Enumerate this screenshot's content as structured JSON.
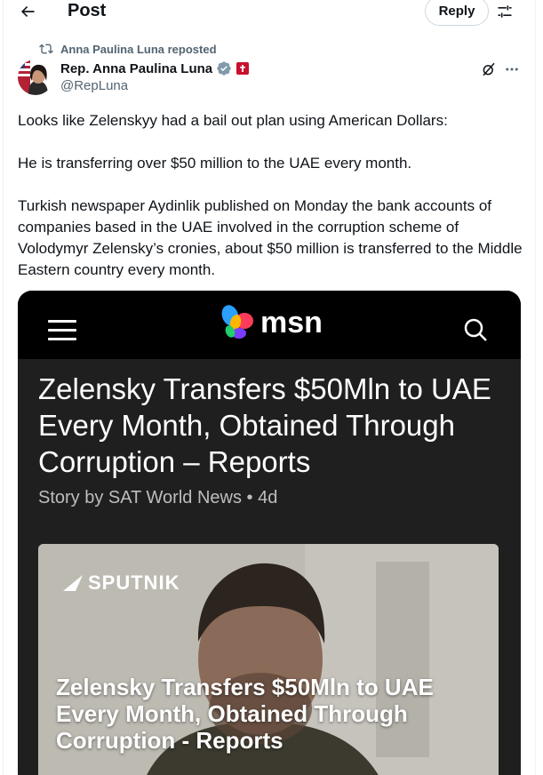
{
  "header": {
    "title": "Post",
    "reply_label": "Reply"
  },
  "repost": {
    "text": "Anna Paulina Luna reposted"
  },
  "author": {
    "name": "Rep. Anna Paulina Luna",
    "handle": "@RepLuna"
  },
  "post": {
    "paragraphs": [
      "Looks like Zelenskyy had a bail out plan using American Dollars:",
      "He is transferring over $50 million to the UAE every month.",
      "Turkish newspaper Aydinlik published on Monday the bank accounts of companies based in the UAE involved in the corruption scheme of Volodymyr Zelensky’s cronies, about $50 million is transferred to the Middle Eastern country every month."
    ]
  },
  "media": {
    "brand": "msn",
    "headline": "Zelensky Transfers $50Mln to UAE Every Month, Obtained Through Corruption – Reports",
    "byline": "Story by SAT World News • 4d",
    "photo_watermark": "SPUTNIK",
    "photo_caption": "Zelensky Transfers $50Mln to UAE Every Month, Obtained Through Corruption - Reports"
  },
  "icons": {
    "back": "back-arrow-icon",
    "adjust": "adjust-icon",
    "repost": "repost-icon",
    "verified": "verified-badge-icon",
    "affiliation": "house-affiliation-icon",
    "grok": "grok-icon",
    "more": "more-icon",
    "menu": "hamburger-menu-icon",
    "search": "search-icon"
  },
  "colors": {
    "text": "#0f1419",
    "muted": "#536471",
    "verified_gray": "#829aab",
    "affiliation_red": "#c8102e",
    "media_bg": "#1f1f1f"
  }
}
